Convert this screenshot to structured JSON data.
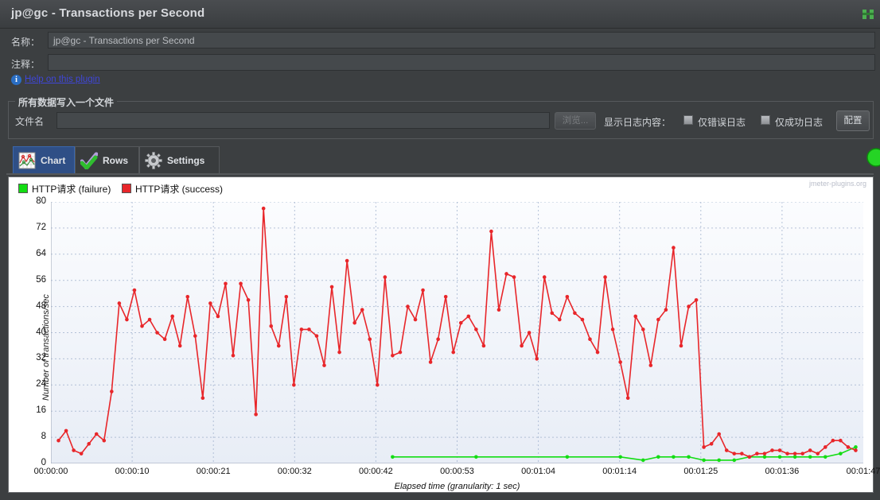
{
  "window": {
    "title": "jp@gc - Transactions per Second",
    "icon": "window-app-icon"
  },
  "form": {
    "name_label": "名称：",
    "name_value": "jp@gc - Transactions per Second",
    "comment_label": "注释：",
    "comment_value": "",
    "help_link": "Help on this plugin",
    "info_icon": "info-icon",
    "info_glyph": "i"
  },
  "file_group": {
    "title": "所有数据写入一个文件",
    "filename_label": "文件名",
    "filename_value": "",
    "browse_label": "浏览...",
    "log_content_label": "显示日志内容：",
    "errors_only_label": "仅错误日志",
    "errors_only_checked": false,
    "success_only_label": "仅成功日志",
    "success_only_checked": false,
    "configure_label": "配置"
  },
  "tabs": [
    {
      "label": "Chart",
      "icon": "chart-icon",
      "active": true
    },
    {
      "label": "Rows",
      "icon": "checkmark-icon",
      "active": false
    },
    {
      "label": "Settings",
      "icon": "gear-icon",
      "active": false
    }
  ],
  "chart_data": {
    "type": "line",
    "title": "",
    "watermark": "jmeter-plugins.org",
    "xlabel": "Elapsed time (granularity: 1 sec)",
    "ylabel": "Number of transactions/sec",
    "grid": true,
    "legend_position": "top-left",
    "ylim": [
      0,
      80
    ],
    "yticks": [
      0,
      8,
      16,
      24,
      32,
      40,
      48,
      56,
      64,
      72,
      80
    ],
    "xticks": [
      "00:00:00",
      "00:00:10",
      "00:00:21",
      "00:00:32",
      "00:00:42",
      "00:00:53",
      "00:01:04",
      "00:01:14",
      "00:01:25",
      "00:01:36",
      "00:01:47"
    ],
    "xlim": [
      0,
      107
    ],
    "colors": {
      "success": "#e8262a",
      "failure": "#13dd13"
    },
    "series": [
      {
        "name": "HTTP请求 (failure)",
        "color": "#13dd13",
        "x": [
          45,
          56,
          68,
          75,
          78,
          80,
          82,
          84,
          86,
          88,
          90,
          92,
          94,
          96,
          98,
          100,
          102,
          104,
          106
        ],
        "values": [
          2,
          2,
          2,
          2,
          1,
          2,
          2,
          2,
          1,
          1,
          1,
          2,
          2,
          2,
          2,
          2,
          2,
          3,
          5
        ]
      },
      {
        "name": "HTTP请求 (success)",
        "color": "#e8262a",
        "x": [
          1,
          2,
          3,
          4,
          5,
          6,
          7,
          8,
          9,
          10,
          11,
          12,
          13,
          14,
          15,
          16,
          17,
          18,
          19,
          20,
          21,
          22,
          23,
          24,
          25,
          26,
          27,
          28,
          29,
          30,
          31,
          32,
          33,
          34,
          35,
          36,
          37,
          38,
          39,
          40,
          41,
          42,
          43,
          44,
          45,
          46,
          47,
          48,
          49,
          50,
          51,
          52,
          53,
          54,
          55,
          56,
          57,
          58,
          59,
          60,
          61,
          62,
          63,
          64,
          65,
          66,
          67,
          68,
          69,
          70,
          71,
          72,
          73,
          74,
          75,
          76,
          77,
          78,
          79,
          80,
          81,
          82,
          83,
          84,
          85,
          86,
          87,
          88,
          89,
          90,
          91,
          92,
          93,
          94,
          95,
          96,
          97,
          98,
          99,
          100,
          101,
          102,
          103,
          104,
          105,
          106
        ],
        "values": [
          7,
          10,
          4,
          3,
          6,
          9,
          7,
          22,
          49,
          44,
          53,
          42,
          44,
          40,
          38,
          45,
          36,
          51,
          39,
          20,
          49,
          45,
          55,
          33,
          55,
          50,
          15,
          78,
          42,
          36,
          51,
          24,
          41,
          41,
          39,
          30,
          54,
          34,
          62,
          43,
          47,
          38,
          24,
          57,
          33,
          34,
          48,
          44,
          53,
          31,
          38,
          51,
          34,
          43,
          45,
          41,
          36,
          71,
          47,
          58,
          57,
          36,
          40,
          32,
          57,
          46,
          44,
          51,
          46,
          44,
          38,
          34,
          57,
          41,
          31,
          20,
          45,
          41,
          30,
          44,
          47,
          66,
          36,
          48,
          50,
          5,
          6,
          9,
          4,
          3,
          3,
          2,
          3,
          3,
          4,
          4,
          3,
          3,
          3,
          4,
          3,
          5,
          7,
          7,
          5,
          4
        ]
      }
    ]
  }
}
